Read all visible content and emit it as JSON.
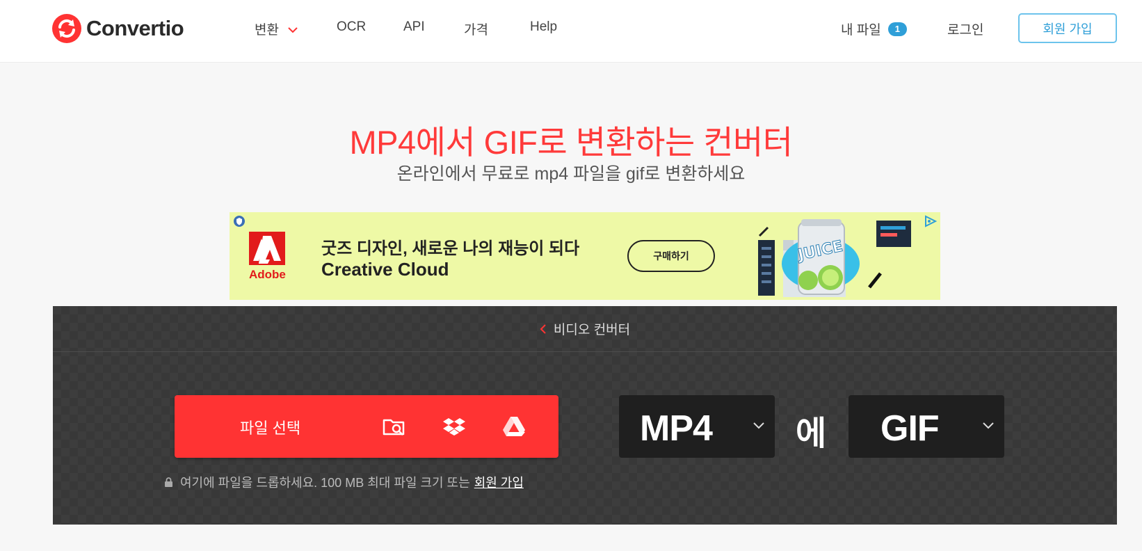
{
  "header": {
    "logo_text": "Convertio",
    "nav": [
      {
        "label": "변환"
      },
      {
        "label": "OCR"
      },
      {
        "label": "API"
      },
      {
        "label": "가격"
      },
      {
        "label": "Help"
      }
    ],
    "my_files_label": "내 파일",
    "my_files_count": "1",
    "login_label": "로그인",
    "signup_label": "회원 가입"
  },
  "hero": {
    "title": "MP4에서 GIF로 변환하는 컨버터",
    "subtitle": "온라인에서 무료로 mp4 파일을 gif로 변환하세요"
  },
  "ad": {
    "brand": "Adobe",
    "line1": "굿즈 디자인, 새로운 나의 재능이 되다",
    "line2": "Creative Cloud",
    "cta": "구매하기",
    "art_text": "JUICE"
  },
  "converter": {
    "back_label": "비디오 컨버터",
    "choose_label": "파일 선택",
    "drop_hint": "여기에 파일을 드롭하세요. 100 MB 최대 파일 크기 또는",
    "drop_link": "회원 가입",
    "from_format": "MP4",
    "to_word": "에",
    "to_format": "GIF"
  },
  "colors": {
    "brand_red": "#ff3333",
    "accent_blue": "#2f9fd8",
    "panel_dark": "#3d3d3d",
    "ad_bg": "#eef9a6"
  },
  "icons": [
    "convertio-logo-icon",
    "chevron-down-icon",
    "chevron-left-icon",
    "folder-search-icon",
    "dropbox-icon",
    "google-drive-icon",
    "lock-icon",
    "adobe-logo-icon",
    "ad-choices-icon"
  ]
}
